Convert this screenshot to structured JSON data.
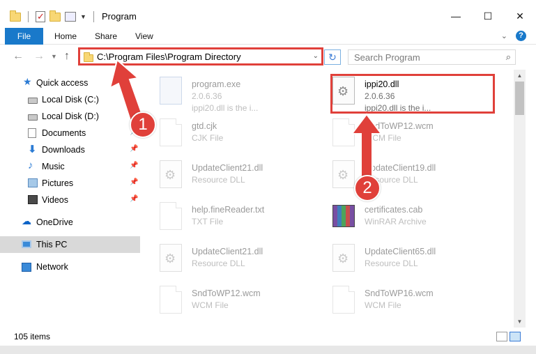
{
  "window": {
    "title": "Program",
    "controls": {
      "minimize": "—",
      "maximize": "☐",
      "close": "✕"
    }
  },
  "ribbon": {
    "tabs": [
      "File",
      "Home",
      "Share",
      "View"
    ],
    "expand_icon": "chevron-down-icon",
    "help_label": "?"
  },
  "nav": {
    "back": "←",
    "forward": "→",
    "up": "↑",
    "address": "C:\\Program Files\\Program Directory",
    "search_placeholder": "Search Program"
  },
  "sidebar": {
    "items": [
      {
        "label": "Quick access",
        "icon": "star-icon",
        "pinned": false
      },
      {
        "label": "Local Disk (C:)",
        "icon": "drive-icon",
        "pinned": false
      },
      {
        "label": "Local Disk (D:)",
        "icon": "drive-icon",
        "pinned": false
      },
      {
        "label": "Documents",
        "icon": "documents-icon",
        "pinned": true
      },
      {
        "label": "Downloads",
        "icon": "download-icon",
        "pinned": true
      },
      {
        "label": "Music",
        "icon": "music-icon",
        "pinned": true
      },
      {
        "label": "Pictures",
        "icon": "pictures-icon",
        "pinned": true
      },
      {
        "label": "Videos",
        "icon": "videos-icon",
        "pinned": true
      },
      {
        "label": "OneDrive",
        "icon": "cloud-icon",
        "pinned": false
      },
      {
        "label": "This PC",
        "icon": "computer-icon",
        "pinned": false,
        "selected": true
      },
      {
        "label": "Network",
        "icon": "network-icon",
        "pinned": false
      }
    ]
  },
  "files": [
    {
      "name": "program.exe",
      "line2": "2.0.6.36",
      "line3": "ippi20.dll is the i...",
      "icon": "exe-icon"
    },
    {
      "name": "ippi20.dll",
      "line2": "2.0.6.36",
      "line3": "ippi20.dll is the i...",
      "icon": "dll-icon"
    },
    {
      "name": "gtd.cjk",
      "line2": "CJK File",
      "icon": "file-icon"
    },
    {
      "name": "SndToWP12.wcm",
      "line2": "WCM File",
      "icon": "file-icon"
    },
    {
      "name": "UpdateClient21.dll",
      "line2": "Resource DLL",
      "icon": "dll-icon"
    },
    {
      "name": "UpdateClient19.dll",
      "line2": "Resource DLL",
      "icon": "dll-icon"
    },
    {
      "name": "help.fineReader.txt",
      "line2": "TXT File",
      "icon": "file-icon"
    },
    {
      "name": "certificates.cab",
      "line2": "WinRAR Archive",
      "icon": "archive-icon"
    },
    {
      "name": "UpdateClient21.dll",
      "line2": "Resource DLL",
      "icon": "dll-icon"
    },
    {
      "name": "UpdateClient65.dll",
      "line2": "Resource DLL",
      "icon": "dll-icon"
    },
    {
      "name": "SndToWP12.wcm",
      "line2": "WCM File",
      "icon": "file-icon"
    },
    {
      "name": "SndToWP16.wcm",
      "line2": "WCM File",
      "icon": "file-icon"
    }
  ],
  "annotations": {
    "step1": "1",
    "step2": "2",
    "color": "#e0403a"
  },
  "status": {
    "item_count": "105 items"
  }
}
